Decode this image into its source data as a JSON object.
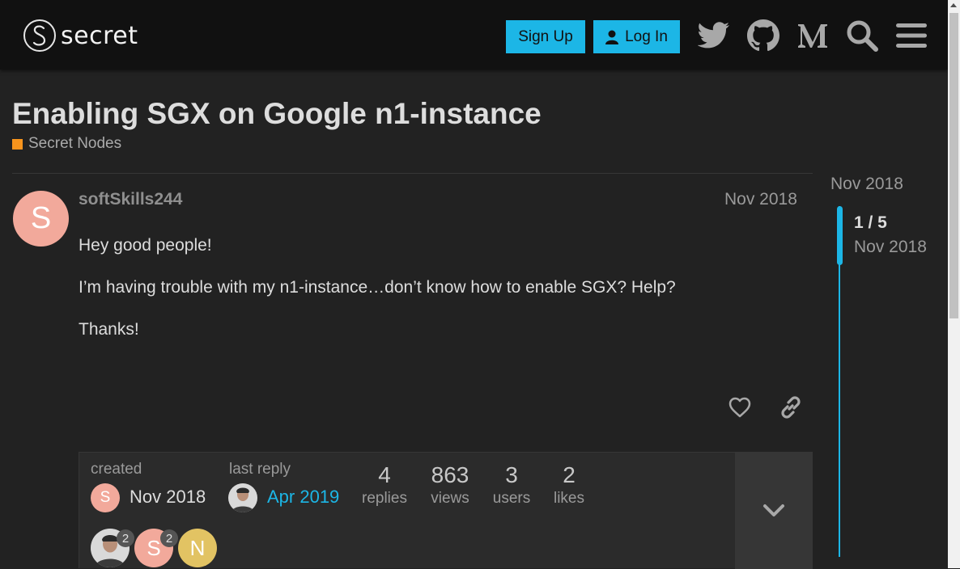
{
  "header": {
    "logo_text": "secret",
    "signup_label": "Sign Up",
    "login_label": "Log In",
    "icons": [
      "twitter-icon",
      "github-icon",
      "medium-icon",
      "search-icon",
      "hamburger-menu-icon"
    ]
  },
  "topic": {
    "title": "Enabling SGX on Google n1-instance",
    "category": "Secret Nodes",
    "category_color": "#f7941d"
  },
  "post": {
    "avatar_letter": "S",
    "avatar_color": "#f2a99b",
    "username": "softSkills244",
    "date": "Nov 2018",
    "paragraphs": [
      "Hey good people!",
      "I’m having trouble with my n1-instance…don’t know how to enable SGX? Help?",
      "Thanks!"
    ]
  },
  "topic_map": {
    "created_label": "created",
    "created_date": "Nov 2018",
    "created_avatar_letter": "S",
    "last_reply_label": "last reply",
    "last_reply_date": "Apr 2019",
    "stats": [
      {
        "value": "4",
        "label": "replies"
      },
      {
        "value": "863",
        "label": "views"
      },
      {
        "value": "3",
        "label": "users"
      },
      {
        "value": "2",
        "label": "likes"
      }
    ],
    "participants": [
      {
        "letter": "",
        "count": "2"
      },
      {
        "letter": "S",
        "count": "2"
      },
      {
        "letter": "N",
        "count": ""
      }
    ]
  },
  "timeline": {
    "start_date": "Nov 2018",
    "position": "1 / 5",
    "current_date": "Nov 2018"
  },
  "colors": {
    "accent": "#1cb6e6",
    "background": "#222222",
    "header": "#111111"
  }
}
